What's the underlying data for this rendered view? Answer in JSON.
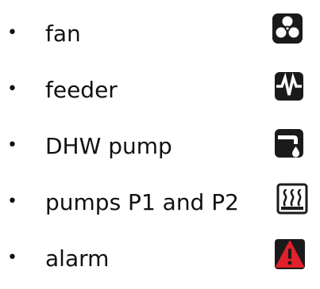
{
  "list": {
    "bullet": "•",
    "items": [
      {
        "label": "fan",
        "icon": "fan-icon"
      },
      {
        "label": "feeder",
        "icon": "feeder-icon"
      },
      {
        "label": "DHW pump",
        "icon": "dhw-pump-icon"
      },
      {
        "label": "pumps P1 and P2",
        "icon": "heating-pumps-icon"
      },
      {
        "label": "alarm",
        "icon": "alarm-icon"
      }
    ]
  },
  "colors": {
    "icon_dark": "#1a1a1a",
    "icon_light": "#ffffff",
    "alarm_red": "#e0202a"
  }
}
